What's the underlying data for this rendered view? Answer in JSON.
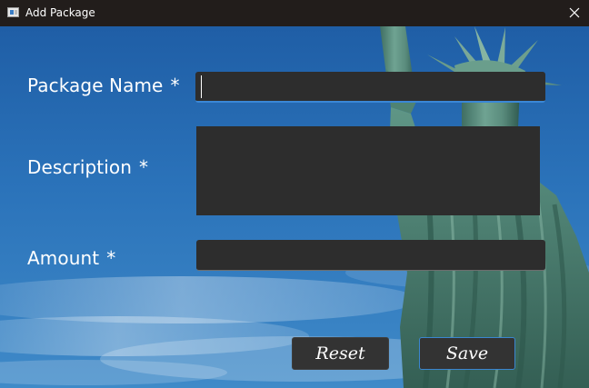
{
  "window": {
    "title": "Add Package",
    "icon": "app-window-icon",
    "close_icon": "close-icon"
  },
  "form": {
    "package_name": {
      "label": "Package Name",
      "required_mark": "*",
      "value": ""
    },
    "description": {
      "label": "Description",
      "required_mark": "*",
      "value": ""
    },
    "amount": {
      "label": "Amount",
      "required_mark": "*",
      "value": ""
    }
  },
  "buttons": {
    "reset": "Reset",
    "save": "Save"
  },
  "colors": {
    "titlebar": "#221d1b",
    "field_bg": "#2d2d2d",
    "focus_accent": "#3a87d6",
    "button_bg": "#333333",
    "sky": "#2a6fb4"
  },
  "background": {
    "description": "statue-of-liberty-photo"
  }
}
